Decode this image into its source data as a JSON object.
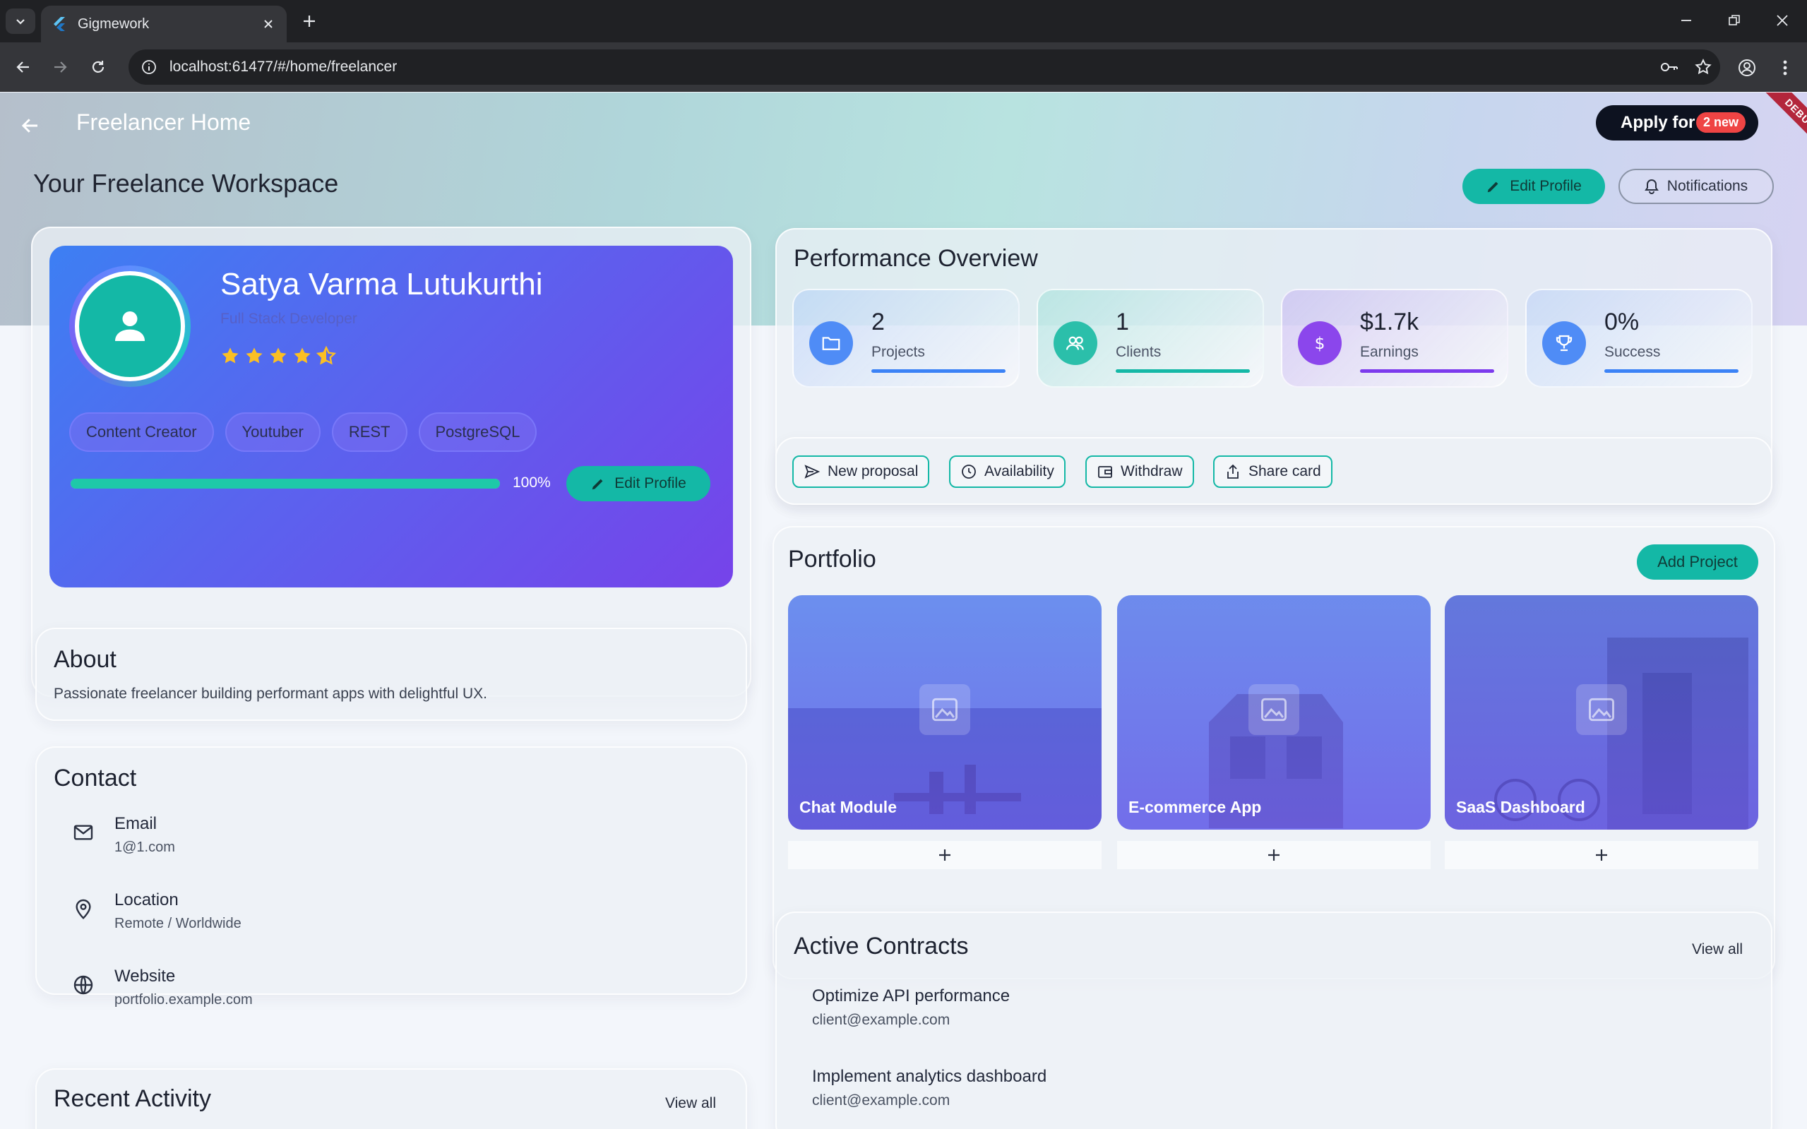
{
  "browser": {
    "tab_title": "Gigmework",
    "url": "localhost:61477/#/home/freelancer"
  },
  "appbar": {
    "title": "Freelancer Home",
    "apply_label": "Apply for W",
    "apply_badge": "2 new",
    "debug_label": "DEBUG"
  },
  "workspace": {
    "title": "Your Freelance Workspace",
    "edit_profile_label": "Edit Profile",
    "notifications_label": "Notifications"
  },
  "profile": {
    "name": "Satya Varma Lutukurthi",
    "role": "Full Stack Developer",
    "rating": 4.5,
    "skills": [
      "Content Creator",
      "Youtuber",
      "REST",
      "PostgreSQL"
    ],
    "completion": 1.0,
    "completion_label": "100%",
    "edit_label": "Edit Profile"
  },
  "about": {
    "heading": "About",
    "text": "Passionate freelancer building performant apps with delightful UX."
  },
  "contact": {
    "heading": "Contact",
    "items": [
      {
        "label": "Email",
        "value": "1@1.com",
        "icon": "mail-icon"
      },
      {
        "label": "Location",
        "value": "Remote / Worldwide",
        "icon": "location-pin-icon"
      },
      {
        "label": "Website",
        "value": "portfolio.example.com",
        "icon": "globe-icon"
      }
    ]
  },
  "activity": {
    "heading": "Recent Activity",
    "view_all": "View all"
  },
  "performance": {
    "heading": "Performance Overview",
    "stats": [
      {
        "value": "2",
        "label": "Projects",
        "icon": "folder-icon",
        "color": "#3b82f6"
      },
      {
        "value": "1",
        "label": "Clients",
        "icon": "users-icon",
        "color": "#14b8a6"
      },
      {
        "value": "$1.7k",
        "label": "Earnings",
        "icon": "dollar-icon",
        "color": "#7c3aed"
      },
      {
        "value": "0%",
        "label": "Success",
        "icon": "trophy-icon",
        "color": "#3b82f6"
      }
    ]
  },
  "actions": [
    {
      "label": "New proposal",
      "icon": "send-icon"
    },
    {
      "label": "Availability",
      "icon": "clock-icon"
    },
    {
      "label": "Withdraw",
      "icon": "wallet-icon"
    },
    {
      "label": "Share card",
      "icon": "share-icon"
    }
  ],
  "portfolio": {
    "heading": "Portfolio",
    "add_label": "Add Project",
    "projects": [
      {
        "title": "Chat Module"
      },
      {
        "title": "E-commerce App"
      },
      {
        "title": "SaaS Dashboard"
      }
    ]
  },
  "contracts": {
    "heading": "Active Contracts",
    "view_all": "View all",
    "items": [
      {
        "title": "Optimize API performance",
        "client": "client@example.com"
      },
      {
        "title": "Implement analytics dashboard",
        "client": "client@example.com"
      }
    ]
  },
  "colors": {
    "accent": "#14b8a6",
    "profile_gradient_start": "#3d7ff3",
    "profile_gradient_end": "#7643ea",
    "star": "#fbbf24"
  }
}
